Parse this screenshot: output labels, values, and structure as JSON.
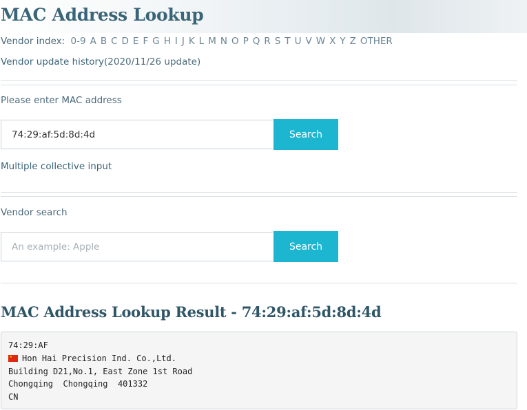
{
  "header": {
    "title": "MAC Address Lookup"
  },
  "vendor_index": {
    "label": "Vendor index:",
    "letters": [
      "0-9",
      "A",
      "B",
      "C",
      "D",
      "E",
      "F",
      "G",
      "H",
      "I",
      "J",
      "K",
      "L",
      "M",
      "N",
      "O",
      "P",
      "Q",
      "R",
      "S",
      "T",
      "U",
      "V",
      "W",
      "X",
      "Y",
      "Z",
      "OTHER"
    ]
  },
  "history": {
    "link": "Vendor update history",
    "note": "(2020/11/26 update)"
  },
  "mac_form": {
    "label": "Please enter MAC address",
    "value": "74:29:af:5d:8d:4d",
    "button": "Search",
    "multi_link": "Multiple collective input"
  },
  "vendor_form": {
    "label": "Vendor search",
    "placeholder": "An example: Apple",
    "button": "Search"
  },
  "result": {
    "title": "MAC Address Lookup Result - 74:29:af:5d:8d:4d",
    "prefix": "74:29:AF",
    "vendor": "Hon Hai Precision Ind. Co.,Ltd.",
    "address1": "Building D21,No.1, East Zone 1st Road",
    "address2": "Chongqing  Chongqing  401332",
    "country": "CN",
    "flag_icon": "china-flag-icon"
  }
}
